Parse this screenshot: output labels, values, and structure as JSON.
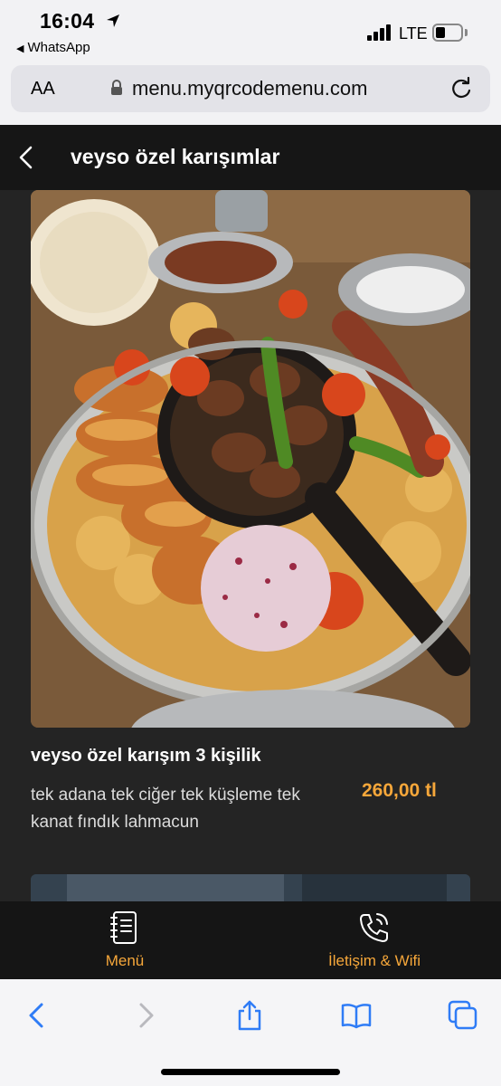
{
  "status_bar": {
    "time": "16:04",
    "back_app": "WhatsApp",
    "network": "LTE"
  },
  "browser": {
    "text_size_label": "AA",
    "url": "menu.myqrcodemenu.com"
  },
  "header": {
    "title": "veyso özel karışımlar"
  },
  "product": {
    "name": "veyso özel karışım 3 kişilik",
    "description": "tek adana tek ciğer tek küşleme tek kanat fındık lahmacun",
    "price": "260,00 tl"
  },
  "tabbar": {
    "menu_label": "Menü",
    "contact_label": "İletişim & Wifi"
  },
  "colors": {
    "accent": "#f6a73a",
    "header_bg": "#161616",
    "page_bg": "#242424",
    "ios_blue": "#2f7cf6"
  },
  "icons": {
    "menu": "notebook-icon",
    "contact": "phone-wifi-icon",
    "back": "chevron-left-icon"
  }
}
